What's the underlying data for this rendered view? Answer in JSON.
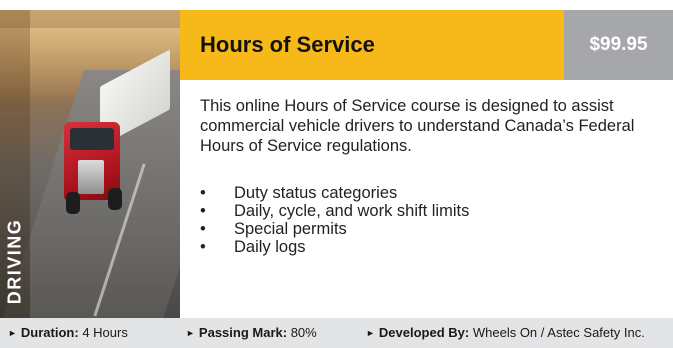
{
  "course": {
    "category": "DRIVING",
    "title": "Hours of Service",
    "price": "$99.95",
    "description": "This online Hours of Service course is designed to assist commercial vehicle drivers to understand Canada’s Federal Hours of Service regulations.",
    "topics": [
      "Duty status categories",
      "Daily, cycle, and work shift limits",
      "Special permits",
      "Daily logs"
    ],
    "bullet_symbol": "•"
  },
  "footer": {
    "arrow_symbol": "►",
    "duration": {
      "label": "Duration:",
      "value": "4 Hours"
    },
    "passing_mark": {
      "label": "Passing Mark:",
      "value": "80%"
    },
    "developed_by": {
      "label": "Developed By:",
      "value": "Wheels On / Astec Safety Inc."
    }
  },
  "colors": {
    "title_bar": "#f7b91a",
    "price_bar": "#a6a7ab",
    "footer_bar": "#e3e4e6"
  }
}
